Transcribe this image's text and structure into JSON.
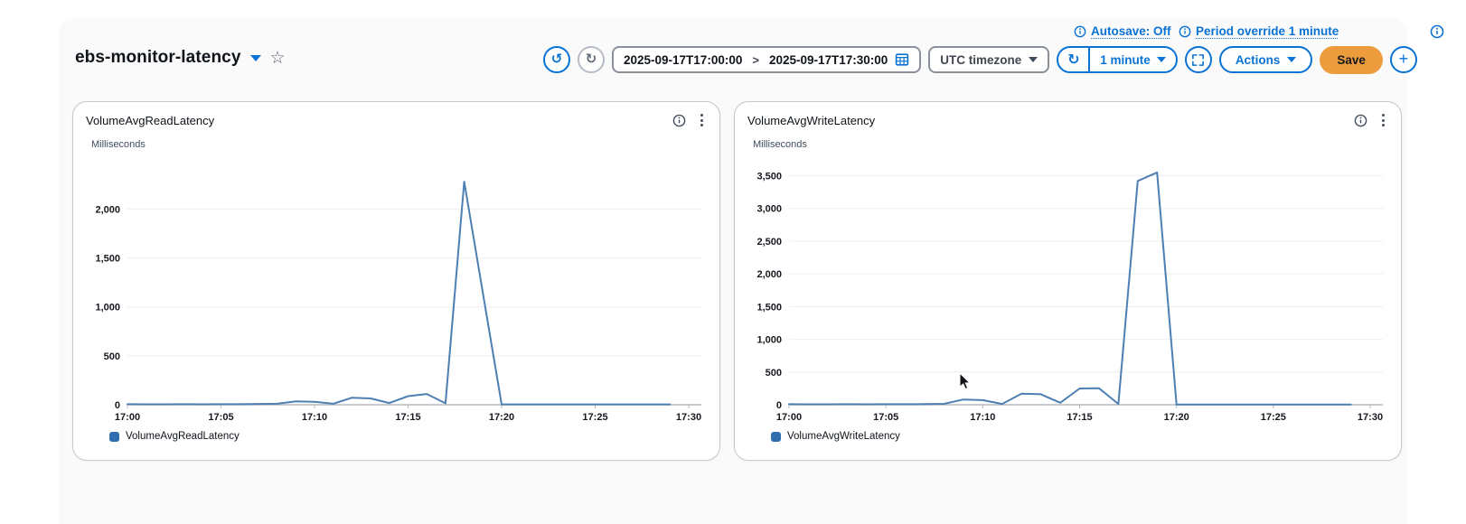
{
  "header": {
    "dashboard_name": "ebs-monitor-latency",
    "autosave_label": "Autosave: Off",
    "period_override_label": "Period override 1 minute",
    "toolbar": {
      "time_start": "2025-09-17T17:00:00",
      "range_separator": ">",
      "time_end": "2025-09-17T17:30:00",
      "timezone": "UTC timezone",
      "refresh_interval": "1 minute",
      "actions": "Actions",
      "save": "Save",
      "add": "+"
    }
  },
  "icons": {
    "undo": "↺",
    "redo": "↻",
    "refresh": "↻",
    "star": "☆"
  },
  "colors": {
    "accent_blue": "#0972d3",
    "save_orange": "#ec9b3d",
    "chart_line": "#4e7fb3",
    "legend_swatch": "#2f6fb0",
    "grid_line": "#edeef0",
    "axis_line": "#b6babf",
    "card_border": "#c6c6cd",
    "text_dark": "#0f141a",
    "text_secondary": "#424650"
  },
  "chart_data": [
    {
      "type": "line",
      "title": "VolumeAvgReadLatency",
      "unit_label": "Milliseconds",
      "legend": "VolumeAvgReadLatency",
      "line_color": "#4e7fb3",
      "x_start": "17:00",
      "x_step_minutes": 1,
      "xlim_minutes": [
        0,
        30
      ],
      "xtick_labels": [
        "17:00",
        "17:05",
        "17:10",
        "17:15",
        "17:20",
        "17:25",
        "17:30"
      ],
      "ytick_values": [
        0,
        500,
        1000,
        1500,
        2000
      ],
      "ytick_labels": [
        "0",
        "500",
        "1,000",
        "1,500",
        "2,000"
      ],
      "ylim": [
        0,
        2475
      ],
      "values": [
        6,
        5,
        5,
        6,
        5,
        6,
        6,
        8,
        10,
        35,
        30,
        10,
        72,
        65,
        18,
        88,
        110,
        15,
        2280,
        1140,
        4,
        4,
        4,
        4,
        4,
        4,
        4,
        4,
        4,
        4
      ]
    },
    {
      "type": "line",
      "title": "VolumeAvgWriteLatency",
      "unit_label": "Milliseconds",
      "legend": "VolumeAvgWriteLatency",
      "line_color": "#4e7fb3",
      "x_start": "17:00",
      "x_step_minutes": 1,
      "xlim_minutes": [
        0,
        30
      ],
      "xtick_labels": [
        "17:00",
        "17:05",
        "17:10",
        "17:15",
        "17:20",
        "17:25",
        "17:30"
      ],
      "ytick_values": [
        0,
        500,
        1000,
        1500,
        2000,
        2500,
        3000,
        3500
      ],
      "ytick_labels": [
        "0",
        "500",
        "1,000",
        "1,500",
        "2,000",
        "2,500",
        "3,000",
        "3,500"
      ],
      "ylim": [
        0,
        3700
      ],
      "values": [
        8,
        7,
        7,
        8,
        7,
        8,
        8,
        10,
        14,
        80,
        70,
        12,
        170,
        160,
        30,
        248,
        252,
        12,
        3420,
        3550,
        4,
        4,
        4,
        4,
        4,
        4,
        4,
        4,
        4,
        4
      ]
    }
  ]
}
